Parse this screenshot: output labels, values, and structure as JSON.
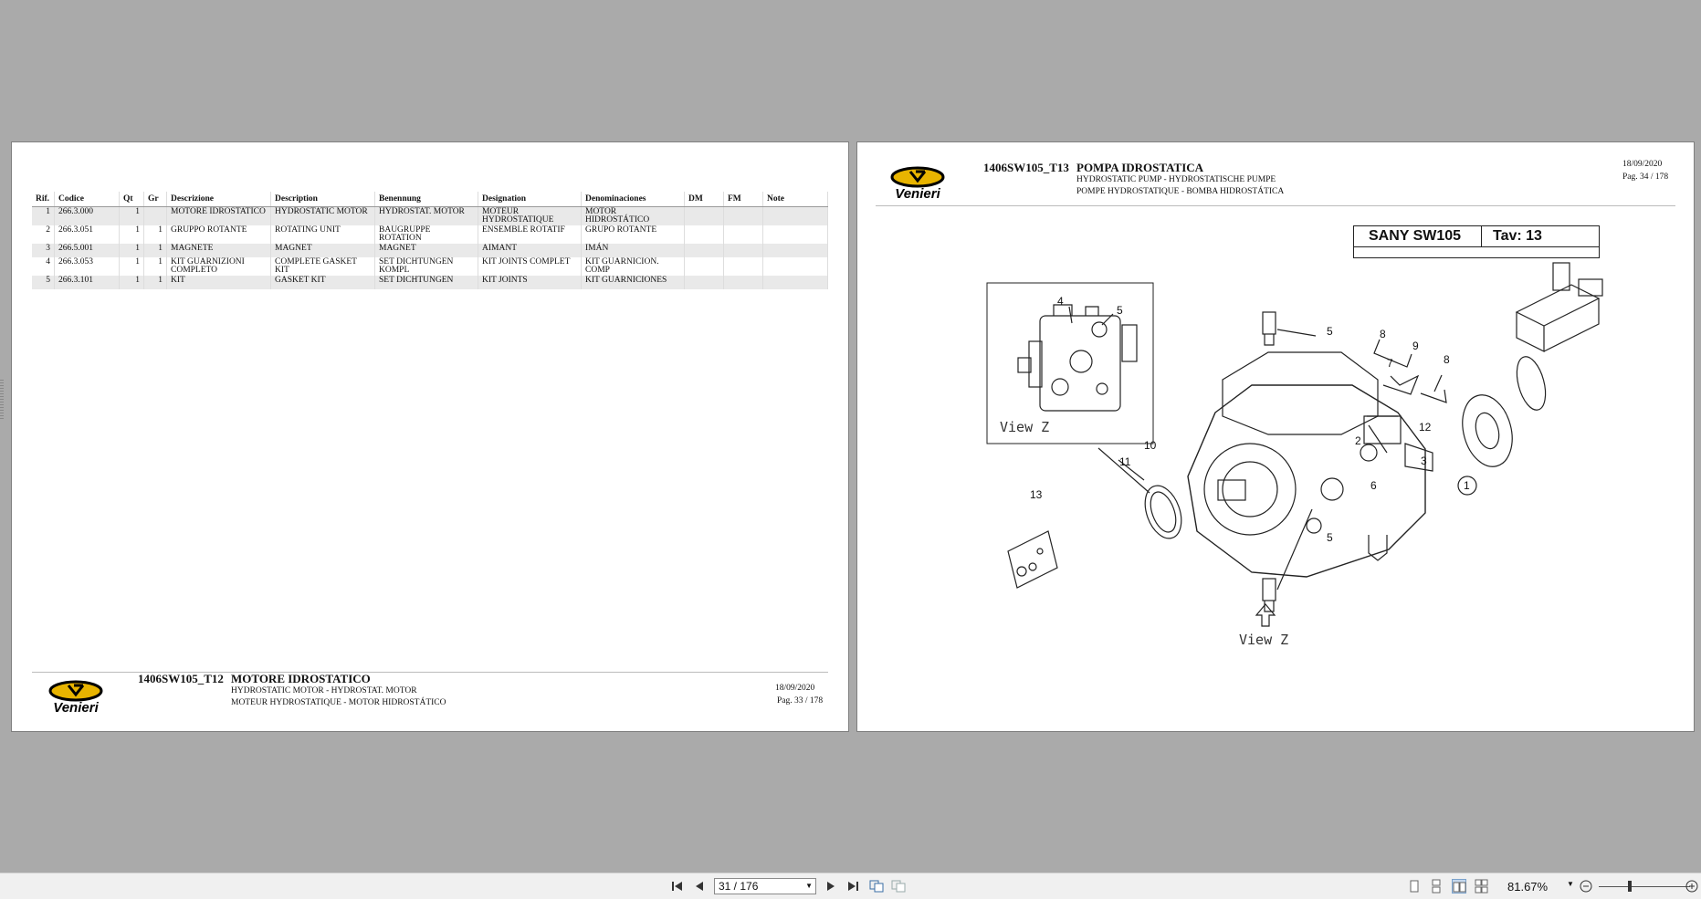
{
  "viewer": {
    "page_input": "31 / 176",
    "zoom": "81.67%",
    "zoom_level": 0.8167
  },
  "left_page": {
    "headers": [
      "Rif.",
      "Codice",
      "Qt",
      "Gr",
      "Descrizione",
      "Description",
      "Benennung",
      "Designation",
      "Denominaciones",
      "DM",
      "FM",
      "Note"
    ],
    "rows": [
      {
        "rif": "1",
        "code": "266.3.000",
        "qt": "1",
        "gr": "",
        "descrizione": "MOTORE IDROSTATICO",
        "description": "HYDROSTATIC MOTOR",
        "benennung": "HYDROSTAT. MOTOR",
        "designation": "MOTEUR HYDROSTATIQUE",
        "denominaciones": "MOTOR HIDROSTÁTICO",
        "dm": "",
        "fm": "",
        "note": ""
      },
      {
        "rif": "2",
        "code": "266.3.051",
        "qt": "1",
        "gr": "1",
        "descrizione": "GRUPPO ROTANTE",
        "description": "ROTATING UNIT",
        "benennung": "BAUGRUPPE ROTATION",
        "designation": "ENSEMBLE ROTATIF",
        "denominaciones": "GRUPO ROTANTE",
        "dm": "",
        "fm": "",
        "note": ""
      },
      {
        "rif": "3",
        "code": "266.5.001",
        "qt": "1",
        "gr": "1",
        "descrizione": "MAGNETE",
        "description": "MAGNET",
        "benennung": "MAGNET",
        "designation": "AIMANT",
        "denominaciones": "IMÁN",
        "dm": "",
        "fm": "",
        "note": ""
      },
      {
        "rif": "4",
        "code": "266.3.053",
        "qt": "1",
        "gr": "1",
        "descrizione": "KIT GUARNIZIONI COMPLETO",
        "description": "COMPLETE GASKET KIT",
        "benennung": "SET DICHTUNGEN KOMPL",
        "designation": "KIT JOINTS COMPLET",
        "denominaciones": "KIT GUARNICION. COMP",
        "dm": "",
        "fm": "",
        "note": ""
      },
      {
        "rif": "5",
        "code": "266.3.101",
        "qt": "1",
        "gr": "1",
        "descrizione": "KIT",
        "description": "GASKET KIT",
        "benennung": "SET DICHTUNGEN",
        "designation": "KIT JOINTS",
        "denominaciones": "KIT GUARNICIONES",
        "dm": "",
        "fm": "",
        "note": ""
      }
    ],
    "footer": {
      "logo_text": "Venieri",
      "code": "1406SW105_T12",
      "title": "MOTORE IDROSTATICO",
      "sub1": "HYDROSTATIC MOTOR - HYDROSTAT. MOTOR",
      "sub2": "MOTEUR HYDROSTATIQUE - MOTOR HIDROSTÁTICO",
      "date": "18/09/2020",
      "page": "Pag. 33 / 178"
    }
  },
  "right_page": {
    "header": {
      "logo_text": "Venieri",
      "code": "1406SW105_T13",
      "title": "POMPA IDROSTATICA",
      "sub1": "HYDROSTATIC PUMP - HYDROSTATISCHE PUMPE",
      "sub2": "POMPE HYDROSTATIQUE - BOMBA HIDROSTÁTICA",
      "date": "18/09/2020",
      "page": "Pag. 34 / 178"
    },
    "tav": {
      "model": "SANY SW105",
      "table": "Tav: 13"
    },
    "diagram": {
      "view_label": "View Z",
      "callouts": [
        "1",
        "2",
        "3",
        "4",
        "5",
        "6",
        "7",
        "8",
        "9",
        "10",
        "11",
        "12",
        "13"
      ]
    }
  }
}
